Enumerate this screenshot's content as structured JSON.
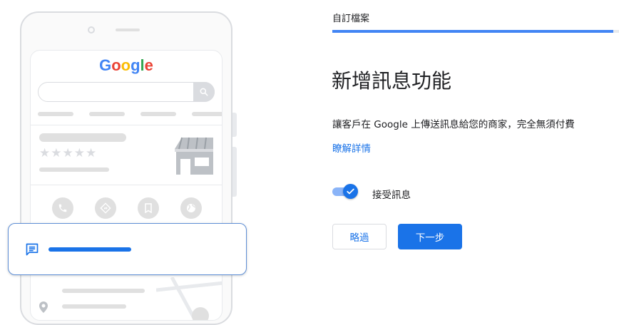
{
  "illustration": {
    "search_engine_logo": {
      "letters": [
        "G",
        "o",
        "o",
        "g",
        "l",
        "e"
      ],
      "colors": [
        "#4285f4",
        "#ea4335",
        "#fbbc05",
        "#4285f4",
        "#34a853",
        "#ea4335"
      ]
    },
    "rating_stars": "★★★★★",
    "action_icons": [
      "phone-icon",
      "directions-icon",
      "bookmark-icon",
      "globe-icon"
    ],
    "message_card_icon": "chat-icon",
    "accent_color": "#1a73e8"
  },
  "wizard": {
    "step_label": "自訂檔案",
    "progress_fraction": 1.0,
    "heading": "新增訊息功能",
    "description": "讓客戶在 Google 上傳送訊息給您的商家，完全無須付費",
    "learn_more": "瞭解詳情",
    "toggle": {
      "label": "接受訊息",
      "checked": true
    },
    "skip_button": "略過",
    "next_button": "下一步"
  },
  "colors": {
    "primary": "#1a73e8",
    "progress": "#4285f4",
    "toggle_track": "#8ab4f8",
    "border": "#dadce0",
    "placeholder_gray": "#e0e0e0"
  }
}
